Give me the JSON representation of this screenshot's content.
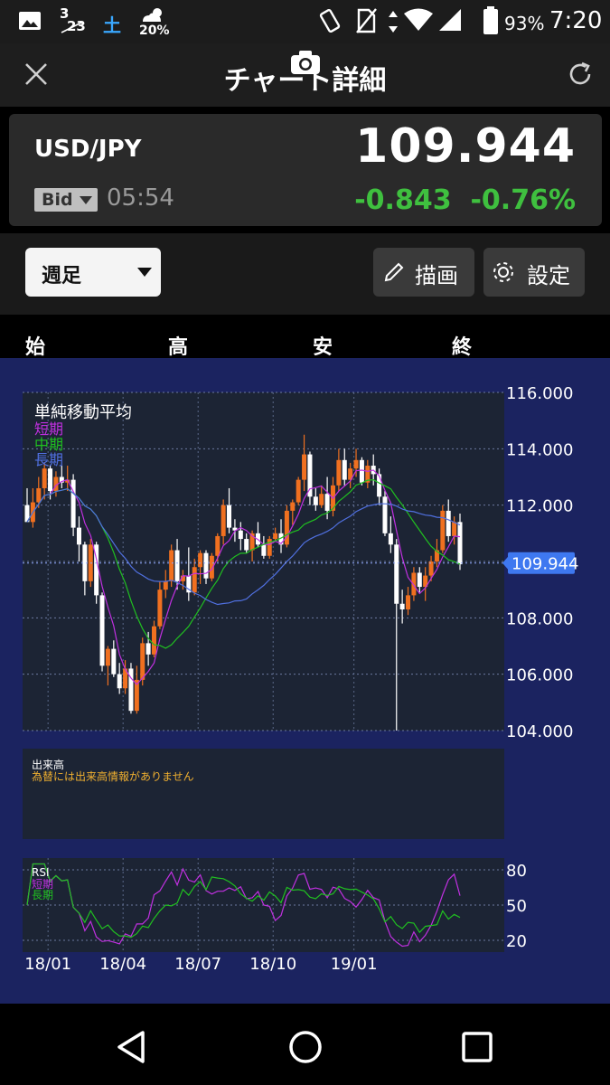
{
  "status_bar": {
    "date_top": "3",
    "date_bottom": "23",
    "weekday": "土",
    "weather_pct": "20%",
    "battery": "93%",
    "time": "7:20"
  },
  "app_bar": {
    "title": "チャート詳細",
    "close_icon": "close-icon",
    "refresh_icon": "refresh-icon"
  },
  "quote": {
    "pair": "USD/JPY",
    "price": "109.944",
    "bid_label": "Bid",
    "time": "05:54",
    "change": "-0.843",
    "change_pct": "-0.76%",
    "change_color": "#3fc03f"
  },
  "controls": {
    "period": "週足",
    "draw_label": "描画",
    "settings_label": "設定"
  },
  "ohlc_headers": [
    "始",
    "高",
    "安",
    "終"
  ],
  "chart_data": [
    {
      "type": "candlestick",
      "title": "",
      "indicator_label": "単純移動平均",
      "series_names": [
        "短期",
        "中期",
        "長期"
      ],
      "series_colors": [
        "#c030e0",
        "#20c020",
        "#5070e0"
      ],
      "up_color": "#f07020",
      "down_color": "#ffffff",
      "ylim": [
        104,
        116
      ],
      "yticks": [
        "116.000",
        "114.000",
        "112.000",
        "110.000",
        "108.000",
        "106.000",
        "104.000"
      ],
      "current_price": "109.944",
      "xticks": [
        "18/01",
        "18/04",
        "18/07",
        "18/10",
        "19/01"
      ],
      "candles": [
        [
          112.0,
          112.6,
          111.6,
          111.4
        ],
        [
          111.4,
          112.6,
          111.2,
          112.1
        ],
        [
          112.1,
          113.0,
          111.9,
          112.6
        ],
        [
          112.6,
          113.5,
          112.2,
          113.3
        ],
        [
          113.3,
          113.4,
          112.2,
          112.5
        ],
        [
          112.5,
          113.2,
          112.3,
          113.0
        ],
        [
          113.0,
          113.4,
          112.6,
          112.8
        ],
        [
          112.8,
          113.4,
          112.5,
          112.9
        ],
        [
          112.9,
          113.1,
          110.9,
          111.2
        ],
        [
          111.2,
          111.6,
          110.0,
          110.6
        ],
        [
          110.6,
          110.7,
          108.8,
          109.3
        ],
        [
          109.3,
          110.8,
          109.1,
          110.6
        ],
        [
          110.6,
          110.7,
          108.5,
          108.8
        ],
        [
          108.8,
          108.9,
          106.1,
          106.3
        ],
        [
          106.3,
          107.0,
          105.6,
          106.9
        ],
        [
          106.9,
          107.2,
          105.9,
          106.0
        ],
        [
          106.0,
          106.4,
          105.3,
          105.5
        ],
        [
          105.5,
          106.5,
          105.3,
          106.2
        ],
        [
          106.2,
          106.4,
          104.6,
          104.7
        ],
        [
          104.7,
          106.3,
          104.6,
          105.8
        ],
        [
          105.8,
          107.3,
          105.6,
          107.1
        ],
        [
          107.1,
          107.5,
          106.3,
          106.7
        ],
        [
          106.7,
          107.9,
          106.6,
          107.7
        ],
        [
          107.7,
          109.3,
          107.6,
          109.0
        ],
        [
          109.0,
          109.7,
          108.7,
          109.3
        ],
        [
          109.3,
          110.6,
          109.1,
          110.4
        ],
        [
          110.4,
          110.8,
          109.0,
          109.3
        ],
        [
          109.3,
          109.7,
          109.0,
          109.5
        ],
        [
          109.5,
          110.5,
          108.6,
          108.9
        ],
        [
          108.9,
          110.1,
          108.8,
          109.8
        ],
        [
          109.8,
          110.4,
          109.2,
          110.3
        ],
        [
          110.3,
          110.4,
          109.2,
          109.4
        ],
        [
          109.4,
          110.3,
          109.3,
          110.2
        ],
        [
          110.2,
          111.0,
          110.0,
          110.9
        ],
        [
          110.9,
          112.2,
          110.6,
          112.0
        ],
        [
          112.0,
          112.6,
          111.0,
          111.2
        ],
        [
          111.2,
          111.5,
          110.7,
          111.1
        ],
        [
          111.1,
          111.4,
          110.4,
          110.8
        ],
        [
          110.8,
          111.0,
          110.3,
          110.4
        ],
        [
          110.4,
          111.1,
          110.0,
          111.0
        ],
        [
          111.0,
          111.4,
          110.5,
          110.6
        ],
        [
          110.6,
          110.9,
          110.1,
          110.2
        ],
        [
          110.2,
          110.9,
          110.1,
          110.8
        ],
        [
          110.8,
          111.2,
          110.7,
          111.0
        ],
        [
          111.0,
          111.5,
          110.3,
          110.6
        ],
        [
          110.6,
          112.0,
          110.5,
          111.8
        ],
        [
          111.8,
          112.2,
          111.3,
          112.1
        ],
        [
          112.1,
          113.0,
          112.0,
          112.9
        ],
        [
          112.9,
          114.5,
          112.5,
          113.8
        ],
        [
          113.8,
          113.9,
          112.0,
          112.3
        ],
        [
          112.3,
          112.6,
          111.8,
          112.0
        ],
        [
          112.0,
          112.7,
          111.9,
          112.4
        ],
        [
          112.4,
          113.0,
          111.5,
          111.8
        ],
        [
          111.8,
          113.0,
          111.6,
          112.7
        ],
        [
          112.7,
          114.0,
          112.5,
          113.6
        ],
        [
          113.6,
          114.0,
          112.7,
          112.9
        ],
        [
          112.9,
          113.5,
          112.6,
          113.3
        ],
        [
          113.3,
          114.0,
          113.0,
          113.6
        ],
        [
          113.6,
          113.7,
          112.7,
          112.8
        ],
        [
          112.8,
          113.6,
          112.6,
          113.4
        ],
        [
          113.4,
          113.8,
          112.7,
          113.1
        ],
        [
          113.1,
          113.3,
          112.0,
          112.3
        ],
        [
          112.3,
          112.5,
          110.9,
          111.0
        ],
        [
          111.0,
          111.6,
          110.3,
          110.6
        ],
        [
          110.6,
          110.8,
          104.0,
          108.5
        ],
        [
          108.5,
          109.0,
          107.8,
          108.3
        ],
        [
          108.3,
          109.1,
          108.1,
          108.8
        ],
        [
          108.8,
          109.8,
          108.6,
          109.6
        ],
        [
          109.6,
          109.8,
          108.9,
          109.1
        ],
        [
          109.1,
          109.8,
          108.6,
          109.5
        ],
        [
          109.5,
          110.2,
          109.3,
          110.0
        ],
        [
          110.0,
          110.8,
          109.8,
          110.4
        ],
        [
          110.4,
          112.0,
          110.3,
          111.8
        ],
        [
          111.8,
          112.2,
          110.7,
          110.9
        ],
        [
          110.9,
          111.6,
          110.6,
          111.4
        ],
        [
          111.4,
          111.7,
          109.7,
          109.9
        ]
      ]
    },
    {
      "type": "volume",
      "title": "出来高",
      "note": "為替には出来高情報がありません"
    },
    {
      "type": "line",
      "title": "RSI",
      "series_names": [
        "短期",
        "長期"
      ],
      "series_colors": [
        "#c030e0",
        "#20c020"
      ],
      "ylim": [
        10,
        90
      ],
      "yticks": [
        "80",
        "50",
        "20"
      ],
      "xticks": [
        "18/01",
        "18/04",
        "18/07",
        "18/10",
        "19/01"
      ]
    }
  ]
}
